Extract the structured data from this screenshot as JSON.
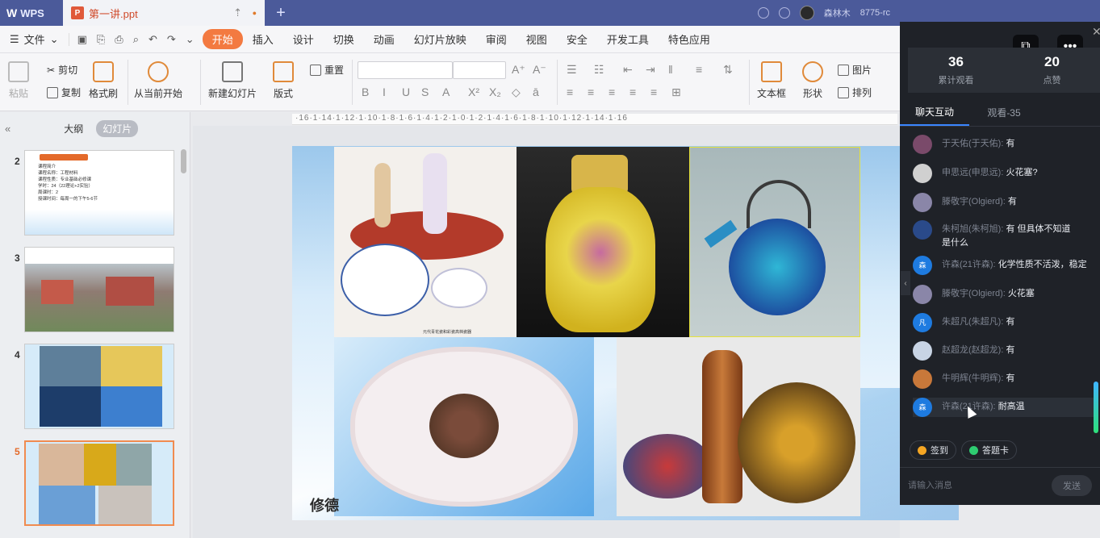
{
  "titlebar": {
    "app_name": "WPS",
    "doc_tab": "第一讲.ppt",
    "new_tab": "+",
    "user_name": "森林木",
    "user_id": "8775-rc"
  },
  "menubar": {
    "file_label": "文件",
    "items": [
      "开始",
      "插入",
      "设计",
      "切换",
      "动画",
      "幻灯片放映",
      "审阅",
      "视图",
      "安全",
      "开发工具",
      "特色应用"
    ],
    "active_index": 0
  },
  "ribbon": {
    "paste": "粘贴",
    "cut": "剪切",
    "copy": "复制",
    "format_painter": "格式刷",
    "play_from_current": "从当前开始",
    "new_slide": "新建幻灯片",
    "layout": "版式",
    "reset": "重置",
    "textbox": "文本框",
    "shape": "形状",
    "picture": "图片",
    "arrange": "排列"
  },
  "left_panel": {
    "collapse_icon": "«",
    "tab_outline": "大纲",
    "tab_slides": "幻灯片",
    "thumbs": [
      {
        "num": "2",
        "lines": [
          "课程简介",
          "课程名称：工程材料",
          "课程性质：专业基础必修课",
          "学时：24（22理论+2实验）",
          "周课时：2",
          "授课时间：每周一的下午5-6节"
        ]
      },
      {
        "num": "3"
      },
      {
        "num": "4"
      },
      {
        "num": "5"
      }
    ],
    "selected_num": "5"
  },
  "ruler_text": "·16·1·14·1·12·1·10·1·8·1·6·1·4·1·2·1·0·1·2·1·4·1·6·1·8·1·10·1·12·1·14·1·16",
  "slide": {
    "caption": "元代青花瓷和彩瓷高档瓷器",
    "corner_text": "修德"
  },
  "live_panel": {
    "stats": [
      {
        "value": "36",
        "label": "累计观看"
      },
      {
        "value": "20",
        "label": "点赞"
      }
    ],
    "tabs": [
      "聊天互动",
      "观看-35"
    ],
    "active_tab": 0,
    "messages": [
      {
        "user": "于天佑(于天佑):",
        "text": "有"
      },
      {
        "user": "申思远(申思远):",
        "text": "火花塞?"
      },
      {
        "user": "滕敬宇(Olgierd):",
        "text": "有"
      },
      {
        "user": "朱柯旭(朱柯旭):",
        "text": "有  但具体不知道",
        "text2": "是什么"
      },
      {
        "user": "许森(21许森):",
        "text": "化学性质不活泼，稳定"
      },
      {
        "user": "滕敬宇(Olgierd):",
        "text": "火花塞"
      },
      {
        "user": "朱超凡(朱超凡):",
        "text": "有"
      },
      {
        "user": "赵超龙(赵超龙):",
        "text": "有"
      },
      {
        "user": "牛明辉(牛明辉):",
        "text": "有"
      },
      {
        "user": "许森(21许森):",
        "text": "耐高温"
      }
    ],
    "avatar_labels": [
      "",
      "",
      "",
      "",
      "森",
      "",
      "凡",
      "",
      "",
      "森"
    ],
    "checkin_btn": "签到",
    "answer_btn": "答题卡",
    "input_placeholder": "请输入消息",
    "send_btn": "发送"
  }
}
